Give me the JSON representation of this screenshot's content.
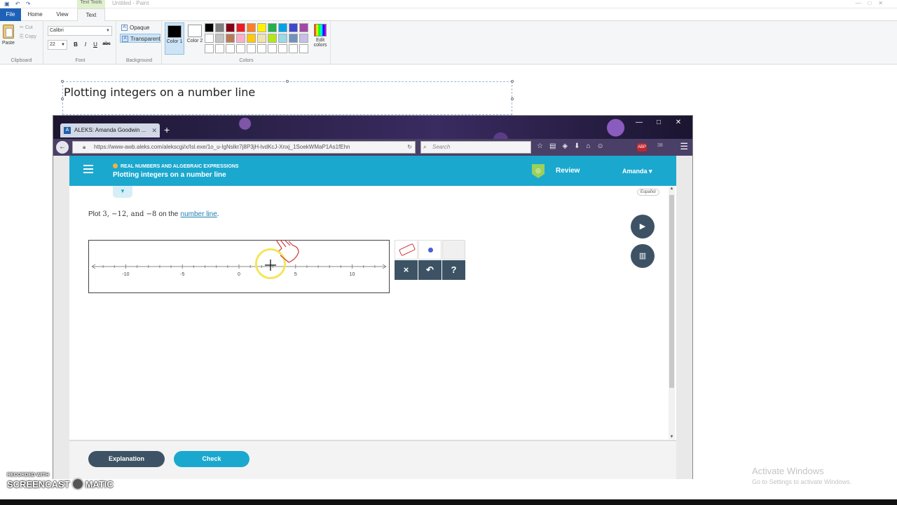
{
  "paint": {
    "tabs": {
      "file": "File",
      "home": "Home",
      "view": "View",
      "text": "Text"
    },
    "clipboard": {
      "paste": "Paste",
      "cut": "Cut",
      "copy": "Copy",
      "label": "Clipboard"
    },
    "font": {
      "family": "Calibri",
      "size": "22",
      "bold": "B",
      "italic": "I",
      "underline": "U",
      "strike": "abc",
      "label": "Font"
    },
    "background": {
      "opaque": "Opaque",
      "transparent": "Transparent",
      "label": "Background"
    },
    "colors": {
      "color1": "Color 1",
      "color2": "Color 2",
      "edit": "Edit colors",
      "label": "Colors",
      "color1_value": "#000000",
      "color2_value": "#ffffff",
      "palette": [
        "#000000",
        "#7f7f7f",
        "#880015",
        "#ed1c24",
        "#ff7f27",
        "#fff200",
        "#22b14c",
        "#00a2e8",
        "#3f48cc",
        "#a349a4",
        "#ffffff",
        "#c3c3c3",
        "#b97a57",
        "#ffaec9",
        "#ffc90e",
        "#efe4b0",
        "#b5e61d",
        "#99d9ea",
        "#7092be",
        "#c8bfe7",
        "#ffffff",
        "#ffffff",
        "#ffffff",
        "#ffffff",
        "#ffffff",
        "#ffffff",
        "#ffffff",
        "#ffffff",
        "#ffffff",
        "#ffffff"
      ]
    },
    "canvas_text": "Plotting integers on a number line"
  },
  "browser": {
    "tab_title": "ALEKS: Amanda Goodwin ...",
    "url": "https://www-awb.aleks.com/alekscgi/x/Isl.exe/1o_u-IgNslkr7j8P3jH-lvdKcJ-Xnxj_1SoekWMaP1As1fEhn",
    "search_placeholder": "Search",
    "abp_count": "38"
  },
  "aleks": {
    "category": "REAL NUMBERS AND ALGEBRAIC EXPRESSIONS",
    "title": "Plotting integers on a number line",
    "review": "Review",
    "user": "Amanda",
    "espanol": "Español",
    "problem_prefix": "Plot",
    "problem_values": "3, −12,  and −8",
    "problem_on": "on the",
    "problem_link": "number line",
    "problem_end": ".",
    "numberline": {
      "min": -13,
      "max": 13,
      "tick_step": 1,
      "labels": [
        "-10",
        "-5",
        "0",
        "5",
        "10"
      ]
    },
    "tools": {
      "clear": "×",
      "undo": "↶",
      "help": "?"
    },
    "buttons": {
      "explanation": "Explanation",
      "check": "Check"
    }
  },
  "overlay": {
    "activate_title": "Activate Windows",
    "activate_sub": "Go to Settings to activate Windows.",
    "recorded_with": "RECORDED WITH",
    "screencast": "SCREENCAST",
    "matic": "MATIC"
  }
}
